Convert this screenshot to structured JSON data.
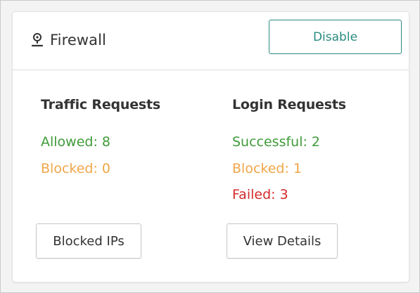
{
  "header": {
    "icon": "map-pin-icon",
    "title": "Firewall",
    "disable_label": "Disable"
  },
  "traffic": {
    "heading": "Traffic Requests",
    "allowed": "Allowed: 8",
    "blocked": "Blocked: 0",
    "button_label": "Blocked IPs"
  },
  "login": {
    "heading": "Login Requests",
    "successful": "Successful: 2",
    "blocked": "Blocked: 1",
    "failed": "Failed: 3",
    "button_label": "View Details"
  },
  "colors": {
    "accent": "#2a8b80",
    "success": "#3f9b3a",
    "warning": "#f0a64a",
    "danger": "#d42a2a"
  }
}
